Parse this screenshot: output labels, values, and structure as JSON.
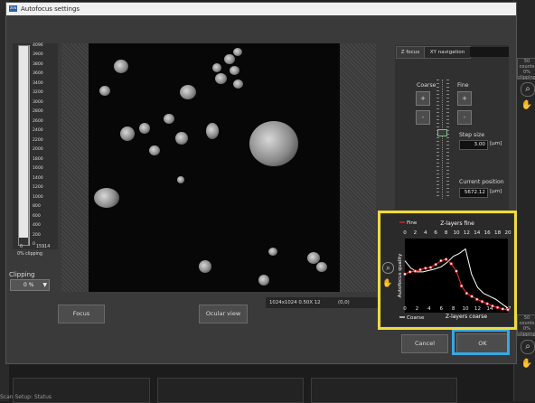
{
  "window": {
    "title": "Autofocus settings",
    "icon": "ZEN"
  },
  "background": {
    "status_text": "Scan Setup: Status",
    "right_panels": [
      {
        "line1": "50",
        "line2": "counts",
        "line3": "0%",
        "line4": "clipping"
      },
      {
        "line1": "50",
        "line2": "counts",
        "line3": "0%",
        "line4": "clipping"
      }
    ],
    "right_icons": [
      "zoom-icon",
      "hand-icon"
    ]
  },
  "histogram": {
    "y_ticks": [
      "4096",
      "3900",
      "3800",
      "3600",
      "3400",
      "3200",
      "3000",
      "2800",
      "2600",
      "2400",
      "2200",
      "2000",
      "1800",
      "1600",
      "1400",
      "1200",
      "1000",
      "800",
      "600",
      "400",
      "200",
      "0"
    ],
    "x_ticks": [
      "0",
      "15914"
    ],
    "clipping_percent": "0% clipping"
  },
  "clipping": {
    "label": "Clipping",
    "value": "0 %"
  },
  "image_info": {
    "size": "1024x1024 0.50X 12",
    "coords": "(0,0)"
  },
  "buttons": {
    "focus": "Focus",
    "ocular": "Ocular view",
    "cancel": "Cancel",
    "ok": "OK"
  },
  "z_panel": {
    "tabs": [
      "Z focus",
      "XY navigation"
    ],
    "coarse_label": "Coarse",
    "fine_label": "Fine",
    "plus": "+",
    "minus": "-",
    "step_size_label": "Step size",
    "step_size_value": "3.00",
    "step_unit": "[µm]",
    "current_position_label": "Current position",
    "current_position_value": "5672.12",
    "position_unit": "[µm]"
  },
  "colors": {
    "highlight_yellow": "#f0da3c",
    "highlight_blue": "#37a8e4",
    "fine_series": "#e03030",
    "coarse_series": "#ffffff"
  },
  "chart_data": {
    "type": "line",
    "top_axis_label": "Z-layers fine",
    "bottom_axis_label": "Z-layers coarse",
    "ylabel": "Autofocus quality",
    "top_ticks": [
      "0",
      "2",
      "4",
      "6",
      "8",
      "10",
      "12",
      "14",
      "16",
      "18",
      "20"
    ],
    "bottom_ticks": [
      "0",
      "2",
      "4",
      "6",
      "8",
      "10",
      "12",
      "14",
      "17"
    ],
    "x_fine_range": [
      0,
      20
    ],
    "x_coarse_range": [
      0,
      17
    ],
    "y_range": [
      0,
      1
    ],
    "series": [
      {
        "name": "Fine",
        "axis": "fine",
        "x": [
          0,
          1,
          2,
          3,
          4,
          5,
          6,
          7,
          8,
          9,
          10,
          11,
          12,
          13,
          14,
          15,
          16,
          17,
          18,
          19,
          20
        ],
        "y": [
          0.52,
          0.55,
          0.56,
          0.58,
          0.6,
          0.61,
          0.65,
          0.7,
          0.72,
          0.66,
          0.56,
          0.36,
          0.26,
          0.22,
          0.18,
          0.15,
          0.12,
          0.09,
          0.07,
          0.05,
          0.04
        ]
      },
      {
        "name": "Coarse",
        "axis": "coarse",
        "x": [
          0,
          1,
          2,
          3,
          4,
          5,
          6,
          7,
          8,
          9,
          10,
          11,
          12,
          13,
          14,
          15,
          16,
          17
        ],
        "y": [
          0.7,
          0.6,
          0.55,
          0.55,
          0.57,
          0.59,
          0.62,
          0.68,
          0.76,
          0.8,
          0.86,
          0.52,
          0.34,
          0.26,
          0.22,
          0.18,
          0.12,
          0.06
        ]
      }
    ],
    "legend_position": "top-left and bottom-left"
  }
}
